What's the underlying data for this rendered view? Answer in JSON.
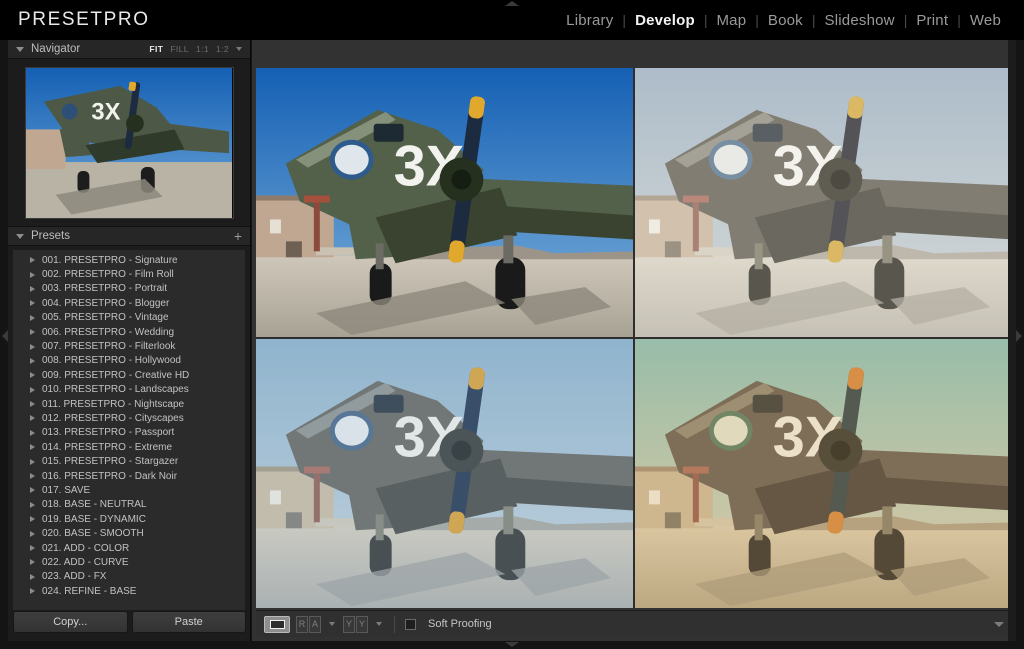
{
  "app": {
    "brand": "PRESETPRO",
    "background_color": "#141414"
  },
  "modules": {
    "items": [
      {
        "label": "Library",
        "active": false
      },
      {
        "label": "Develop",
        "active": true
      },
      {
        "label": "Map",
        "active": false
      },
      {
        "label": "Book",
        "active": false
      },
      {
        "label": "Slideshow",
        "active": false
      },
      {
        "label": "Print",
        "active": false
      },
      {
        "label": "Web",
        "active": false
      }
    ],
    "separator": "|"
  },
  "navigator": {
    "title": "Navigator",
    "zoom_levels": [
      {
        "label": "FIT",
        "active": true
      },
      {
        "label": "FILL",
        "active": false
      },
      {
        "label": "1:1",
        "active": false
      },
      {
        "label": "1:2",
        "active": false
      }
    ]
  },
  "presets": {
    "title": "Presets",
    "add_label": "+",
    "items": [
      {
        "label": "001. PRESETPRO - Signature"
      },
      {
        "label": "002. PRESETPRO - Film Roll"
      },
      {
        "label": "003. PRESETPRO - Portrait"
      },
      {
        "label": "004. PRESETPRO - Blogger"
      },
      {
        "label": "005. PRESETPRO - Vintage"
      },
      {
        "label": "006. PRESETPRO - Wedding"
      },
      {
        "label": "007. PRESETPRO - Filterlook"
      },
      {
        "label": "008. PRESETPRO - Hollywood"
      },
      {
        "label": "009. PRESETPRO - Creative HD"
      },
      {
        "label": "010. PRESETPRO - Landscapes"
      },
      {
        "label": "011. PRESETPRO - Nightscape"
      },
      {
        "label": "012. PRESETPRO - Cityscapes"
      },
      {
        "label": "013. PRESETPRO - Passport"
      },
      {
        "label": "014. PRESETPRO - Extreme"
      },
      {
        "label": "015. PRESETPRO - Stargazer"
      },
      {
        "label": "016. PRESETPRO - Dark Noir"
      },
      {
        "label": "017. SAVE"
      },
      {
        "label": "018. BASE - NEUTRAL"
      },
      {
        "label": "019. BASE - DYNAMIC"
      },
      {
        "label": "020. BASE - SMOOTH"
      },
      {
        "label": "021. ADD - COLOR"
      },
      {
        "label": "022. ADD - CURVE"
      },
      {
        "label": "023. ADD - FX"
      },
      {
        "label": "024. REFINE - BASE"
      }
    ]
  },
  "copy_paste": {
    "copy_label": "Copy...",
    "paste_label": "Paste"
  },
  "toolbar": {
    "loupe_view_label": "",
    "before_after_left": "R",
    "before_after_right": "A",
    "split_left": "Y",
    "split_right": "Y",
    "soft_proofing_label": "Soft Proofing",
    "soft_proofing_checked": false
  },
  "preview": {
    "subject": "C-47 Skytrain military transport aircraft with 3X nose marking on desert tarmac",
    "quadrants": [
      {
        "name": "original-vivid",
        "position": "top-left",
        "sky_top": "#1560b4",
        "sky_bottom": "#6fa7d8",
        "fuselage": "#53604a",
        "fuselage_shadow": "#39432f",
        "ground": "#b9b3a6",
        "ground_shadow": "#8d887c",
        "building": "#bfa791",
        "prop": "#1d2b40",
        "prop_tip": "#e0a82c",
        "marking": "#f2f2ee",
        "overlay": "rgba(0,0,0,0)"
      },
      {
        "name": "faded-desaturated",
        "position": "top-right",
        "sky_top": "#9fb2c4",
        "sky_bottom": "#c8cfd4",
        "fuselage": "#6a655a",
        "fuselage_shadow": "#4f4b42",
        "ground": "#cdc6ba",
        "ground_shadow": "#a8a296",
        "building": "#cbb8a2",
        "prop": "#31313a",
        "prop_tip": "#d7ae49",
        "marking": "#f5f3ee",
        "overlay": "rgba(238,236,228,0.18)"
      },
      {
        "name": "cool-matte",
        "position": "bottom-left",
        "sky_top": "#8fb3cd",
        "sky_bottom": "#c3d2dc",
        "fuselage": "#6a6a66",
        "fuselage_shadow": "#4d4f4c",
        "ground": "#c7c2b6",
        "ground_shadow": "#9fa0a0",
        "building": "#cbbda6",
        "prop": "#283a55",
        "prop_tip": "#d9a33c",
        "marking": "#f0efea",
        "overlay": "rgba(150,185,210,0.16)"
      },
      {
        "name": "warm-vintage-teal",
        "position": "bottom-right",
        "sky_top": "#8fc0b4",
        "sky_bottom": "#d9d3b6",
        "fuselage": "#6d6253",
        "fuselage_shadow": "#4f463a",
        "ground": "#d3c3a4",
        "ground_shadow": "#a89madd",
        "building": "#cfbb97",
        "prop": "#3b4a4a",
        "prop_tip": "#d98a3c",
        "marking": "#f3eddc",
        "overlay": "rgba(205,165,110,0.18)"
      }
    ],
    "navigator_thumb": {
      "sky_top": "#1560b4",
      "sky_bottom": "#6fa7d8",
      "fuselage": "#4d5946",
      "ground": "#b9b3a6",
      "prop": "#1d2b40",
      "prop_tip": "#e0a82c",
      "marking": "#f2f2ee",
      "building": "#bfa791"
    }
  }
}
